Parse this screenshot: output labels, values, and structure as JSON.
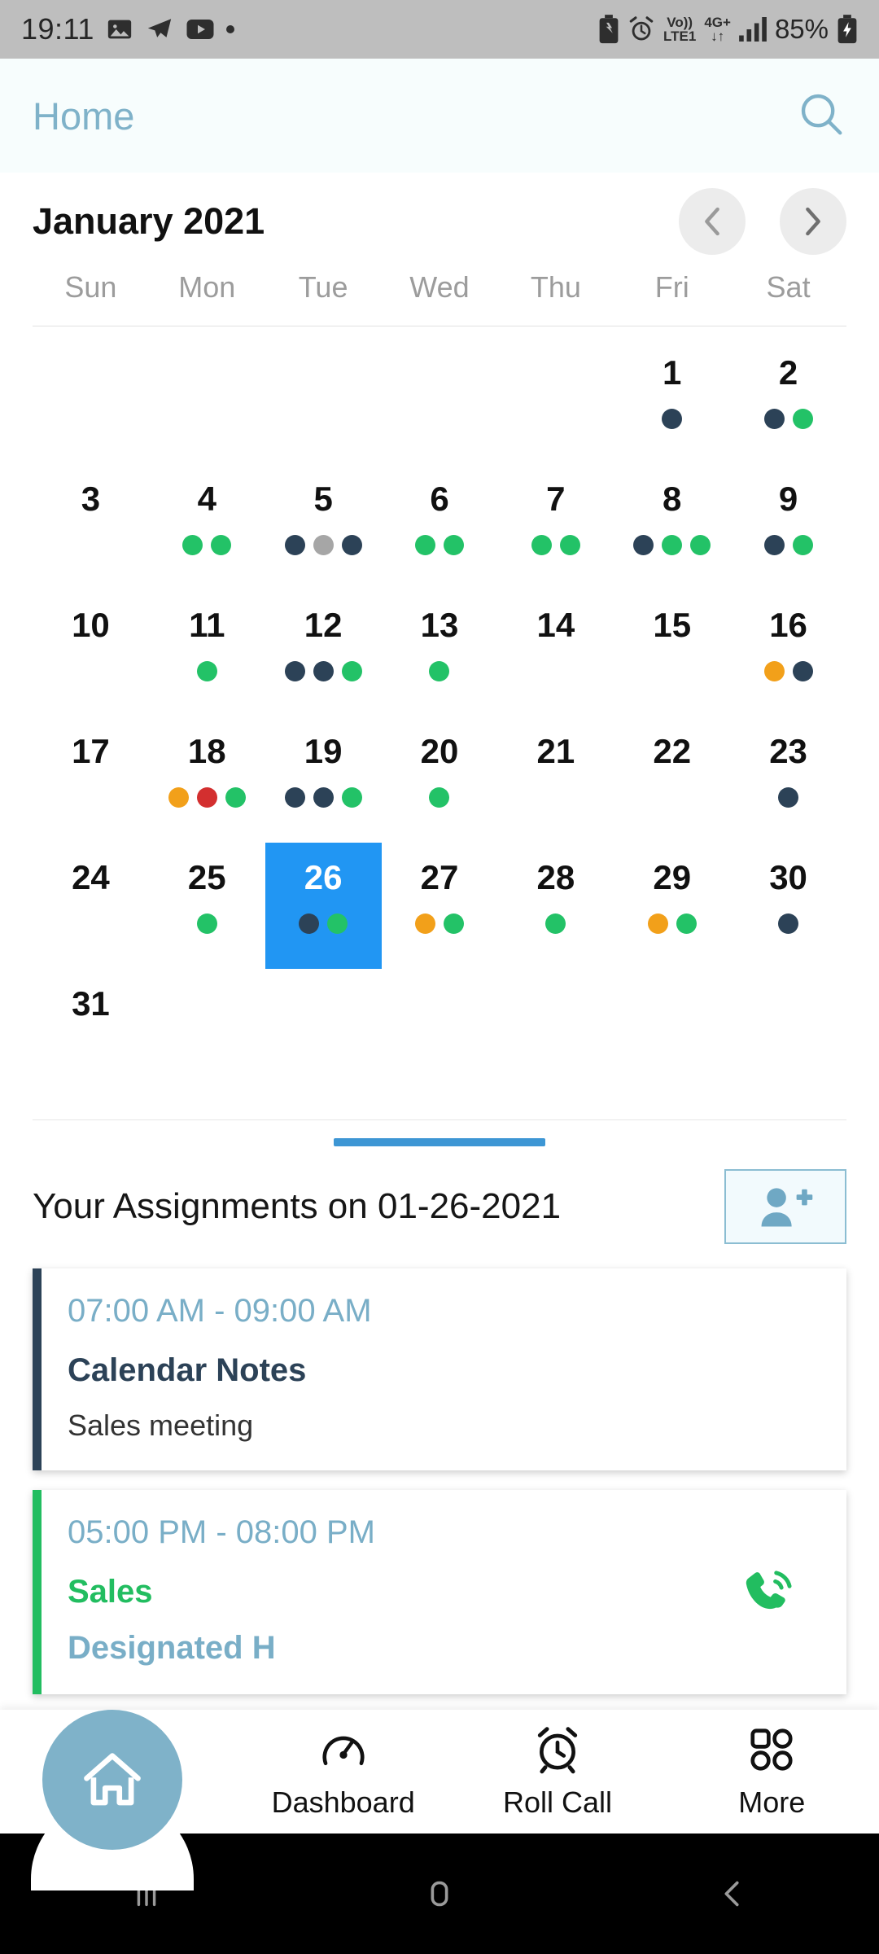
{
  "status_bar": {
    "time": "19:11",
    "left_icons": [
      "image-icon",
      "telegram-icon",
      "youtube-icon",
      "dot-icon"
    ],
    "right_icons": [
      "battery-saver-icon",
      "alarm-icon"
    ],
    "volte_line1": "Vo))",
    "volte_line2": "LTE1",
    "network_gen": "4G+",
    "data_arrows": "↓↑",
    "signal": "signal-bars-icon",
    "battery_percent": "85%",
    "battery_icon": "charging-battery-icon"
  },
  "header": {
    "title": "Home",
    "search_icon": "search-icon",
    "accent": "#7fb2c9"
  },
  "calendar": {
    "month_label": "January 2021",
    "prev_icon": "chevron-left-icon",
    "next_icon": "chevron-right-icon",
    "weekdays": [
      "Sun",
      "Mon",
      "Tue",
      "Wed",
      "Thu",
      "Fri",
      "Sat"
    ],
    "selected_day": 26,
    "selected_color": "#2196f3",
    "dot_colors": {
      "navy": "#2c4257",
      "green": "#23c267",
      "gray": "#a6a6a6",
      "orange": "#f2a01a",
      "red": "#d32f2f"
    },
    "weeks": [
      [
        {
          "day": "",
          "dots": []
        },
        {
          "day": "",
          "dots": []
        },
        {
          "day": "",
          "dots": []
        },
        {
          "day": "",
          "dots": []
        },
        {
          "day": "",
          "dots": []
        },
        {
          "day": "1",
          "dots": [
            "navy"
          ]
        },
        {
          "day": "2",
          "dots": [
            "navy",
            "green"
          ]
        }
      ],
      [
        {
          "day": "3",
          "dots": []
        },
        {
          "day": "4",
          "dots": [
            "green",
            "green"
          ]
        },
        {
          "day": "5",
          "dots": [
            "navy",
            "gray",
            "navy"
          ]
        },
        {
          "day": "6",
          "dots": [
            "green",
            "green"
          ]
        },
        {
          "day": "7",
          "dots": [
            "green",
            "green"
          ]
        },
        {
          "day": "8",
          "dots": [
            "navy",
            "green",
            "green"
          ]
        },
        {
          "day": "9",
          "dots": [
            "navy",
            "green"
          ]
        }
      ],
      [
        {
          "day": "10",
          "dots": []
        },
        {
          "day": "11",
          "dots": [
            "green"
          ]
        },
        {
          "day": "12",
          "dots": [
            "navy",
            "navy",
            "green"
          ]
        },
        {
          "day": "13",
          "dots": [
            "green"
          ]
        },
        {
          "day": "14",
          "dots": []
        },
        {
          "day": "15",
          "dots": []
        },
        {
          "day": "16",
          "dots": [
            "orange",
            "navy"
          ]
        }
      ],
      [
        {
          "day": "17",
          "dots": []
        },
        {
          "day": "18",
          "dots": [
            "orange",
            "red",
            "green"
          ]
        },
        {
          "day": "19",
          "dots": [
            "navy",
            "navy",
            "green"
          ]
        },
        {
          "day": "20",
          "dots": [
            "green"
          ]
        },
        {
          "day": "21",
          "dots": []
        },
        {
          "day": "22",
          "dots": []
        },
        {
          "day": "23",
          "dots": [
            "navy"
          ]
        }
      ],
      [
        {
          "day": "24",
          "dots": []
        },
        {
          "day": "25",
          "dots": [
            "green"
          ]
        },
        {
          "day": "26",
          "dots": [
            "navy",
            "green"
          ],
          "selected": true
        },
        {
          "day": "27",
          "dots": [
            "orange",
            "green"
          ]
        },
        {
          "day": "28",
          "dots": [
            "green"
          ]
        },
        {
          "day": "29",
          "dots": [
            "orange",
            "green"
          ]
        },
        {
          "day": "30",
          "dots": [
            "navy"
          ]
        }
      ],
      [
        {
          "day": "31",
          "dots": []
        },
        {
          "day": "",
          "dots": []
        },
        {
          "day": "",
          "dots": []
        },
        {
          "day": "",
          "dots": []
        },
        {
          "day": "",
          "dots": []
        },
        {
          "day": "",
          "dots": []
        },
        {
          "day": "",
          "dots": []
        }
      ]
    ]
  },
  "assignments": {
    "heading": "Your Assignments on 01-26-2021",
    "add_icon": "add-person-icon",
    "events": [
      {
        "time": "07:00 AM - 09:00 AM",
        "title": "Calendar Notes",
        "description": "Sales meeting",
        "bar_color": "#2c4257",
        "title_color": "#2c4257"
      },
      {
        "time": "05:00 PM - 08:00 PM",
        "title": "Sales",
        "description": "Designated H",
        "bar_color": "#22bd60",
        "title_color": "#22bd60",
        "call_icon": "phone-call-icon"
      }
    ]
  },
  "bottom_nav": {
    "fab": {
      "icon": "home-icon",
      "color": "#7fb2c9"
    },
    "items": [
      {
        "label": "Dashboard",
        "icon": "speedometer-icon"
      },
      {
        "label": "Roll Call",
        "icon": "alarm-clock-icon"
      },
      {
        "label": "More",
        "icon": "grid-icon"
      }
    ]
  },
  "android_nav": {
    "recents_icon": "recents-icon",
    "home_icon": "home-square-icon",
    "back_icon": "back-chevron-icon"
  }
}
